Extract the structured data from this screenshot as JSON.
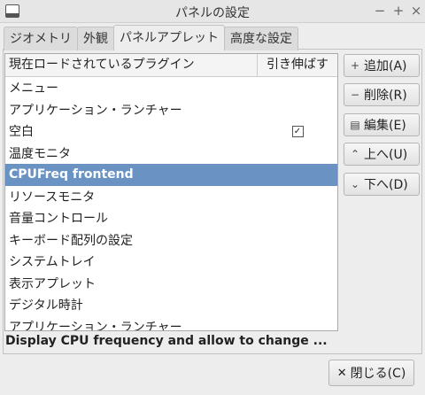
{
  "window": {
    "title": "パネルの設定",
    "minimize": "−",
    "maximize": "+",
    "close": "×"
  },
  "tabs": [
    {
      "label": "ジオメトリ"
    },
    {
      "label": "外観"
    },
    {
      "label": "パネルアプレット",
      "active": true
    },
    {
      "label": "高度な設定"
    }
  ],
  "plugins": {
    "header_name": "現在ロードされているプラグイン",
    "header_stretch": "引き伸ばす",
    "checkmark": "✓",
    "rows": [
      {
        "name": "メニュー",
        "stretch": false
      },
      {
        "name": "アプリケーション・ランチャー",
        "stretch": false
      },
      {
        "name": "空白",
        "stretch": true
      },
      {
        "name": "温度モニタ",
        "stretch": false
      },
      {
        "name": "CPUFreq frontend",
        "stretch": false,
        "selected": true
      },
      {
        "name": "リソースモニタ",
        "stretch": false
      },
      {
        "name": "音量コントロール",
        "stretch": false
      },
      {
        "name": "キーボード配列の設定",
        "stretch": false
      },
      {
        "name": "システムトレイ",
        "stretch": false
      },
      {
        "name": "表示アプレット",
        "stretch": false
      },
      {
        "name": "デジタル時計",
        "stretch": false
      },
      {
        "name": "アプリケーション・ランチャー",
        "stretch": false
      }
    ]
  },
  "buttons": {
    "add": {
      "icon": "+",
      "label": "追加(A)"
    },
    "remove": {
      "icon": "−",
      "label": "削除(R)"
    },
    "edit": {
      "icon": "▤",
      "label": "編集(E)"
    },
    "up": {
      "icon": "⌃",
      "label": "上へ(U)"
    },
    "down": {
      "icon": "⌄",
      "label": "下へ(D)"
    },
    "close": {
      "icon": "✕",
      "label": "閉じる(C)"
    }
  },
  "description": "Display CPU frequency and allow to change ..."
}
